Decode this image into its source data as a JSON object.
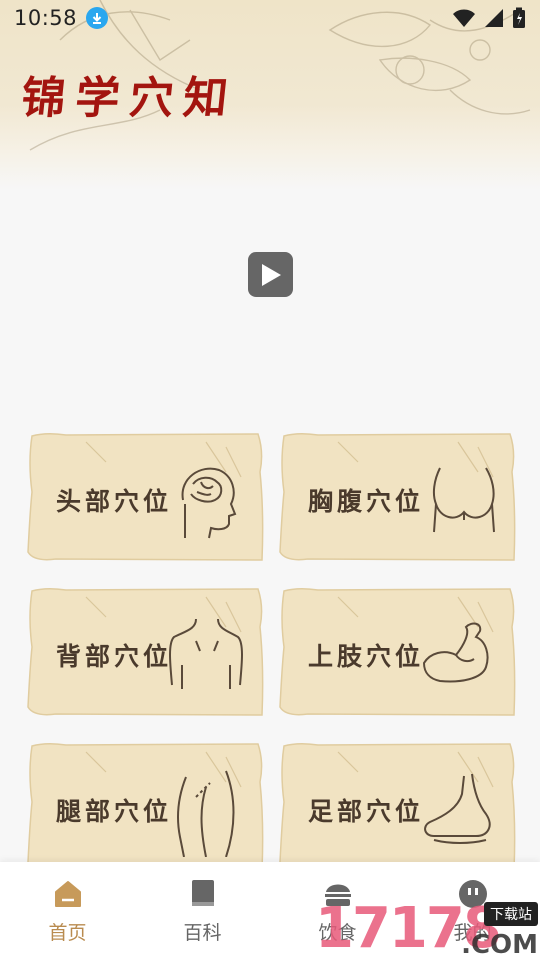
{
  "status_bar": {
    "time": "10:58",
    "icons": [
      "download-icon",
      "wifi-icon",
      "signal-icon",
      "battery-icon"
    ]
  },
  "header": {
    "title": "锦学穴知"
  },
  "video": {
    "play_icon": "play-icon"
  },
  "cards": [
    {
      "label": "头部穴位",
      "icon": "head-brain-icon"
    },
    {
      "label": "胸腹穴位",
      "icon": "chest-icon"
    },
    {
      "label": "背部穴位",
      "icon": "back-icon"
    },
    {
      "label": "上肢穴位",
      "icon": "arm-muscle-icon"
    },
    {
      "label": "腿部穴位",
      "icon": "leg-icon"
    },
    {
      "label": "足部穴位",
      "icon": "foot-icon"
    }
  ],
  "bottom_nav": [
    {
      "label": "首页",
      "icon": "home-icon",
      "active": true
    },
    {
      "label": "百科",
      "icon": "book-icon",
      "active": false
    },
    {
      "label": "饮食",
      "icon": "food-bowl-icon",
      "active": false
    },
    {
      "label": "我的",
      "icon": "profile-icon",
      "active": false
    }
  ],
  "watermark": {
    "number": "17178",
    "suffix": ".COM",
    "tag": "下载站"
  },
  "colors": {
    "title_red": "#a3150f",
    "active_nav": "#b98b4f",
    "parchment": "#efe4c8",
    "card_text": "#4a3a2c"
  }
}
